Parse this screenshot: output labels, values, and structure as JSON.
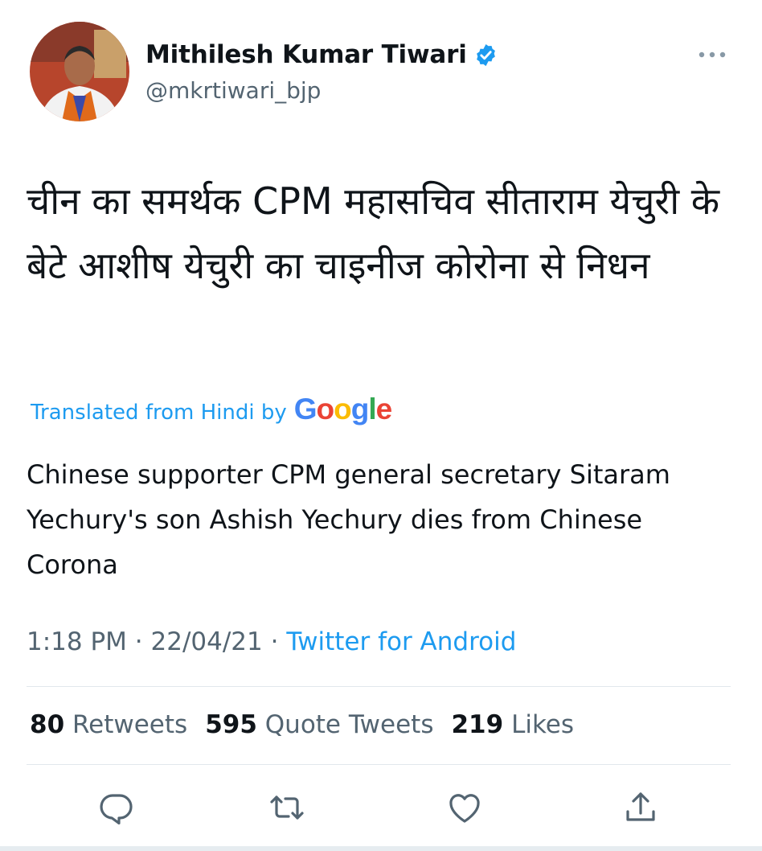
{
  "author": {
    "name": "Mithilesh Kumar Tiwari",
    "handle": "@mkrtiwari_bjp",
    "verified": true
  },
  "tweet": {
    "text_hindi": "चीन का समर्थक CPM महासचिव सीताराम येचुरी के बेटे आशीष येचुरी का चाइनीज कोरोना से निधन",
    "translated_label": "Translated from Hindi by",
    "translation_provider": "Google",
    "translation": "Chinese supporter CPM general secretary Sitaram Yechury's son Ashish Yechury dies from Chinese Corona"
  },
  "meta": {
    "time": "1:18 PM",
    "separator": "·",
    "date": "22/04/21",
    "source": "Twitter for Android"
  },
  "stats": {
    "retweets_count": "80",
    "retweets_label": "Retweets",
    "quotes_count": "595",
    "quotes_label": "Quote Tweets",
    "likes_count": "219",
    "likes_label": "Likes"
  },
  "actions": [
    {
      "name": "reply",
      "icon": "reply-icon"
    },
    {
      "name": "retweet",
      "icon": "retweet-icon"
    },
    {
      "name": "like",
      "icon": "heart-icon"
    },
    {
      "name": "share",
      "icon": "share-icon"
    }
  ],
  "colors": {
    "accent": "#1d9bf0",
    "verified": "#1d9bf0",
    "text_primary": "#0f1419",
    "text_secondary": "#536471",
    "divider": "#e1e8ed"
  }
}
